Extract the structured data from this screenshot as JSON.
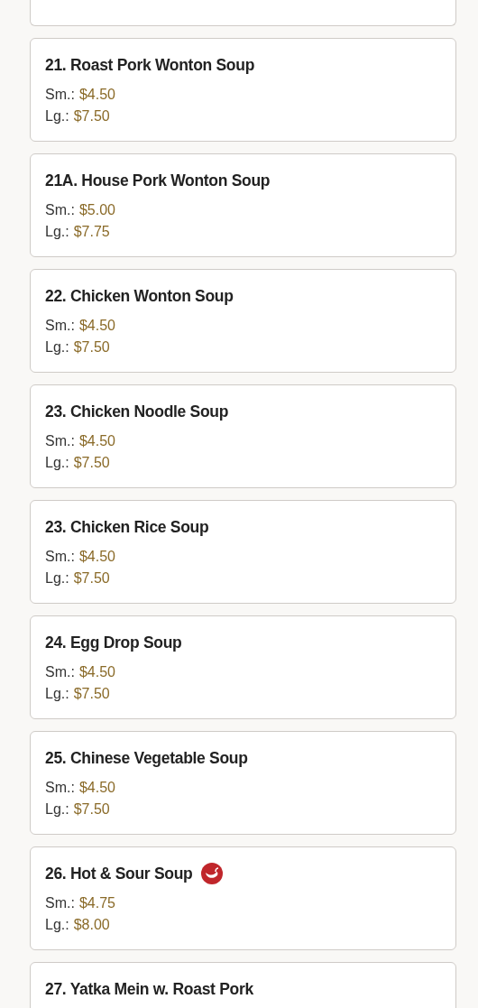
{
  "items": [
    {
      "kind": "cut"
    },
    {
      "kind": "full",
      "title": "21. Roast Pork Wonton Soup",
      "prices": [
        {
          "label": "Sm.:",
          "price": "$4.50"
        },
        {
          "label": "Lg.:",
          "price": "$7.50"
        }
      ],
      "spicy": false
    },
    {
      "kind": "full",
      "title": "21A. House Pork Wonton Soup",
      "prices": [
        {
          "label": "Sm.:",
          "price": "$5.00"
        },
        {
          "label": "Lg.:",
          "price": "$7.75"
        }
      ],
      "spicy": false
    },
    {
      "kind": "full",
      "title": "22. Chicken Wonton Soup",
      "prices": [
        {
          "label": "Sm.:",
          "price": "$4.50"
        },
        {
          "label": "Lg.:",
          "price": "$7.50"
        }
      ],
      "spicy": false
    },
    {
      "kind": "full",
      "title": "23. Chicken Noodle Soup",
      "prices": [
        {
          "label": "Sm.:",
          "price": "$4.50"
        },
        {
          "label": "Lg.:",
          "price": "$7.50"
        }
      ],
      "spicy": false
    },
    {
      "kind": "full",
      "title": "23. Chicken Rice Soup",
      "prices": [
        {
          "label": "Sm.:",
          "price": "$4.50"
        },
        {
          "label": "Lg.:",
          "price": "$7.50"
        }
      ],
      "spicy": false
    },
    {
      "kind": "full",
      "title": "24. Egg Drop Soup",
      "prices": [
        {
          "label": "Sm.:",
          "price": "$4.50"
        },
        {
          "label": "Lg.:",
          "price": "$7.50"
        }
      ],
      "spicy": false
    },
    {
      "kind": "full",
      "title": "25. Chinese Vegetable Soup",
      "prices": [
        {
          "label": "Sm.:",
          "price": "$4.50"
        },
        {
          "label": "Lg.:",
          "price": "$7.50"
        }
      ],
      "spicy": false
    },
    {
      "kind": "full",
      "title": "26. Hot & Sour Soup",
      "prices": [
        {
          "label": "Sm.:",
          "price": "$4.75"
        },
        {
          "label": "Lg.:",
          "price": "$8.00"
        }
      ],
      "spicy": true
    },
    {
      "kind": "full",
      "title": "27. Yatka Mein w. Roast Pork",
      "spicy": false
    }
  ]
}
